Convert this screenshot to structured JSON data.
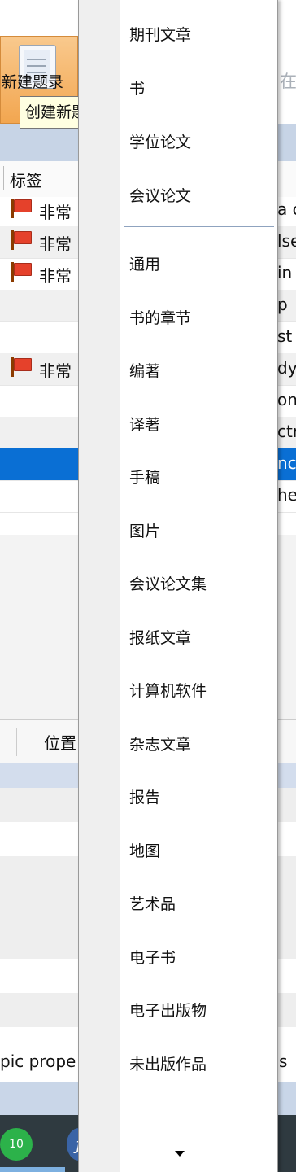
{
  "toolbar": {
    "new_button_label": "新建题录",
    "tooltip": "创建新题录",
    "search_fragment": "在"
  },
  "grid": {
    "column_tags": "标签",
    "rows": [
      {
        "tag": "非常",
        "right": "a c",
        "flag": true,
        "style": "plain"
      },
      {
        "tag": "非常",
        "right": "lse",
        "flag": true,
        "style": "alt"
      },
      {
        "tag": "非常",
        "right": "in",
        "flag": true,
        "style": "plain"
      },
      {
        "tag": "",
        "right": "p",
        "flag": false,
        "style": "alt"
      },
      {
        "tag": "",
        "right": "st",
        "flag": false,
        "style": "plain"
      },
      {
        "tag": "非常",
        "right": "dy",
        "flag": true,
        "style": "alt"
      },
      {
        "tag": "",
        "right": "on",
        "flag": false,
        "style": "plain"
      },
      {
        "tag": "",
        "right": "ctr",
        "flag": false,
        "style": "alt"
      },
      {
        "tag": "",
        "right": "nc",
        "flag": false,
        "style": "selected"
      },
      {
        "tag": "",
        "right": "he",
        "flag": false,
        "style": "plain"
      }
    ]
  },
  "lower_panel": {
    "column_location": "位置",
    "row_text_left": "pic prope",
    "row_text_right": "s"
  },
  "menu": {
    "items_top": [
      "期刊文章",
      "书",
      "学位论文",
      "会议论文"
    ],
    "items_bottom": [
      "通用",
      "书的章节",
      "编著",
      "译著",
      "手稿",
      "图片",
      "会议论文集",
      "报纸文章",
      "计算机软件",
      "杂志文章",
      "报告",
      "地图",
      "艺术品",
      "电子书",
      "电子出版物",
      "未出版作品"
    ]
  },
  "taskbar": {
    "evernote_label": "10"
  },
  "colors": {
    "selection": "#0a6fd4",
    "toolbar_button": "#f2a650",
    "header_band": "#c7d4e6"
  }
}
